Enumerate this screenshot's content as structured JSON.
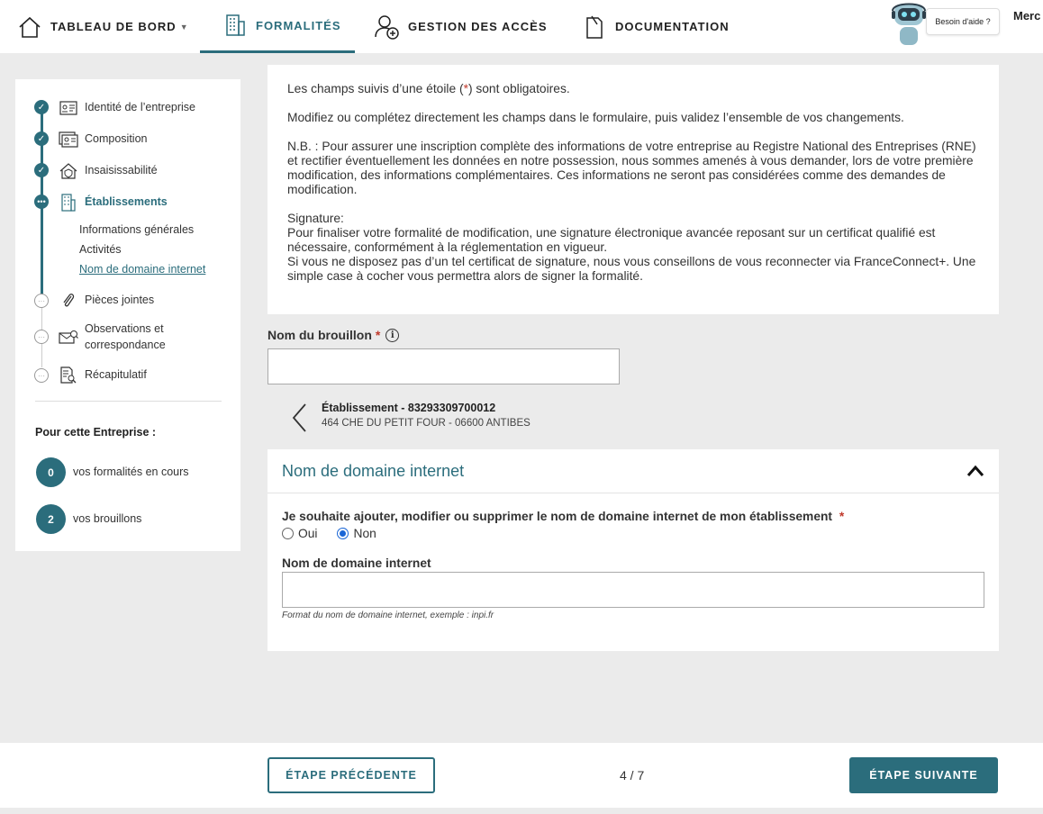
{
  "nav": {
    "dashboard": "TABLEAU DE BORD",
    "formalities": "FORMALITÉS",
    "access": "GESTION DES ACCÈS",
    "documentation": "DOCUMENTATION",
    "help": "Besoin d'aide ?",
    "user": "Merc"
  },
  "sidebar": {
    "steps": [
      {
        "label": "Identité de l’entreprise",
        "state": "done",
        "icon": "id-card-icon"
      },
      {
        "label": "Composition",
        "state": "done",
        "icon": "people-card-icon"
      },
      {
        "label": "Insaisissabilité",
        "state": "done",
        "icon": "house-shield-icon"
      },
      {
        "label": "Établissements",
        "state": "current",
        "icon": "building-icon"
      },
      {
        "label": "Pièces jointes",
        "state": "todo",
        "icon": "paperclip-icon"
      },
      {
        "label": "Observations et correspondance",
        "state": "todo",
        "icon": "envelope-icon"
      },
      {
        "label": "Récapitulatif",
        "state": "todo",
        "icon": "document-search-icon"
      }
    ],
    "substeps": [
      "Informations générales",
      "Activités",
      "Nom de domaine internet"
    ],
    "company_title": "Pour cette Entreprise :",
    "formalities_count": "0",
    "formalities_label": "vos formalités en cours",
    "drafts_count": "2",
    "drafts_label": "vos brouillons"
  },
  "info": {
    "p1_before": "Les champs suivis d’une étoile (",
    "p1_star": "*",
    "p1_after": ") sont obligatoires.",
    "p2": "Modifiez ou complétez directement les champs dans le formulaire, puis validez l’ensemble de vos changements.",
    "p3": "N.B. : Pour assurer une inscription complète des informations de votre entreprise au Registre National des Entreprises (RNE) et rectifier éventuellement les données en notre possession, nous sommes amenés à vous demander, lors de votre première modification, des informations complémentaires. Ces informations ne seront pas considérées comme des demandes de modification.",
    "sig_title": "Signature:",
    "sig_1": "Pour finaliser votre formalité de modification, une signature électronique avancée reposant sur un certificat qualifié est nécessaire, conformément à la réglementation en vigueur.",
    "sig_2": "Si vous ne disposez pas d’un tel certificat de signature, nous vous conseillons de vous reconnecter via FranceConnect+. Une simple case à cocher vous permettra alors de signer la formalité."
  },
  "draft": {
    "label": "Nom du brouillon",
    "required": "*",
    "value": ""
  },
  "establishment": {
    "title": "Établissement - 83293309700012",
    "address": "464 CHE DU PETIT FOUR - 06600 ANTIBES"
  },
  "domain_panel": {
    "title": "Nom de domaine internet",
    "question": "Je souhaite ajouter, modifier ou supprimer le nom de domaine internet de mon établissement",
    "required": "*",
    "options": [
      "Oui",
      "Non"
    ],
    "selected": "Non",
    "field_label": "Nom de domaine internet",
    "field_value": "",
    "hint": "Format du nom de domaine internet, exemple : inpi.fr"
  },
  "footer": {
    "prev": "ÉTAPE PRÉCÉDENTE",
    "page": "4 / 7",
    "next": "ÉTAPE SUIVANTE"
  },
  "colors": {
    "accent": "#2b6d7c",
    "required": "#c0392b",
    "radio": "#1a66d6"
  }
}
